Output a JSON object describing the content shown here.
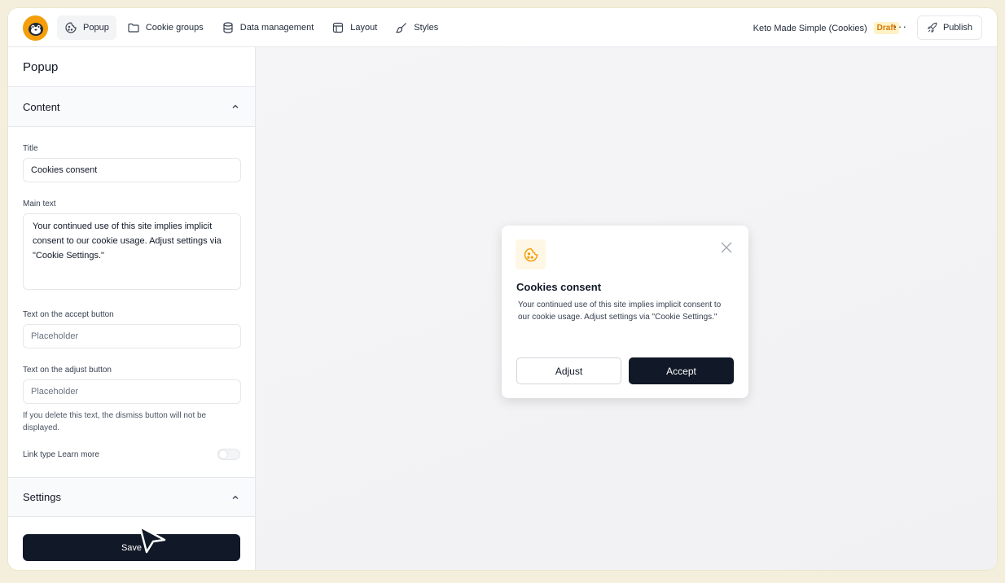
{
  "nav": {
    "items": [
      {
        "label": "Popup",
        "icon": "cookie-icon"
      },
      {
        "label": "Cookie groups",
        "icon": "folder-icon"
      },
      {
        "label": "Data management",
        "icon": "database-icon"
      },
      {
        "label": "Layout",
        "icon": "layout-icon"
      },
      {
        "label": "Styles",
        "icon": "brush-icon"
      }
    ],
    "active": "Popup"
  },
  "project": {
    "name": "Keto Made Simple (Cookies)",
    "status": "Draft"
  },
  "header": {
    "more_label": "···",
    "publish_label": "Publish"
  },
  "sidebar": {
    "panel_title": "Popup",
    "content_section": "Content",
    "fields": {
      "title_label": "Title",
      "title_value": "Cookies consent",
      "main_text_label": "Main text",
      "main_text_value": "Your continued use of this site implies implicit consent to our cookie usage. Adjust settings via \"Cookie Settings.\"",
      "accept_label": "Text on the accept button",
      "accept_placeholder": "Placeholder",
      "adjust_label": "Text on the adjust button",
      "adjust_placeholder": "Placeholder",
      "adjust_hint": "If you delete this text, the dismiss button will not be displayed.",
      "link_type_label": "Link type Learn more"
    },
    "settings_section": "Settings",
    "save_label": "Save"
  },
  "popup": {
    "title": "Cookies consent",
    "text": "Your continued use of this site implies implicit consent to our cookie usage. Adjust settings via \"Cookie Settings.\"",
    "adjust_label": "Adjust",
    "accept_label": "Accept"
  },
  "colors": {
    "accent": "#f59e0b",
    "primary": "#111827",
    "badge_bg": "#fef3c7",
    "badge_text": "#d97706"
  }
}
